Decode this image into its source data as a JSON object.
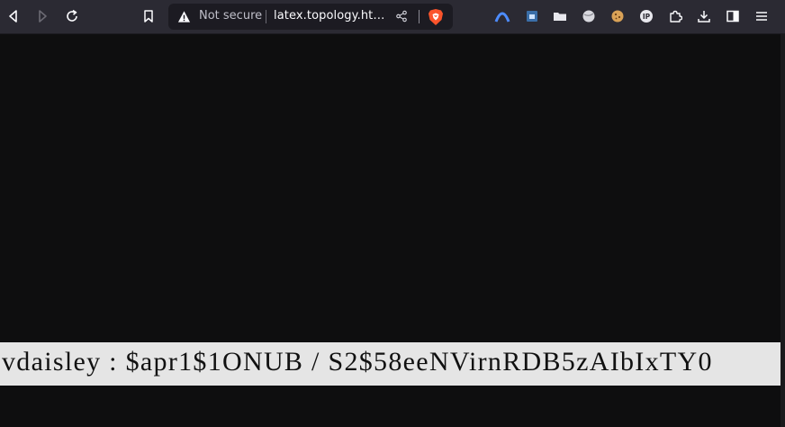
{
  "browser": {
    "security_label": "Not secure",
    "url_display": "latex.topology.ht…"
  },
  "toolbar": {
    "buttons": [
      "back",
      "forward",
      "reload",
      "bookmark"
    ],
    "extensions": [
      "arc-icon",
      "extension-blue-icon",
      "folder-icon",
      "globe-icon",
      "cookie-icon",
      "ip-icon",
      "puzzle-icon",
      "download-icon",
      "sidebar-icon",
      "menu-icon"
    ]
  },
  "page": {
    "secret_line": "vdaisley : $apr1$1ONUB / S2$58eeNVirnRDB5zAIbIxTY0"
  },
  "colors": {
    "toolbar_bg": "#2b2a33",
    "page_bg": "#0e0e0f",
    "highlight_bg": "#e5e5e5",
    "brave_orange": "#fb542b"
  }
}
